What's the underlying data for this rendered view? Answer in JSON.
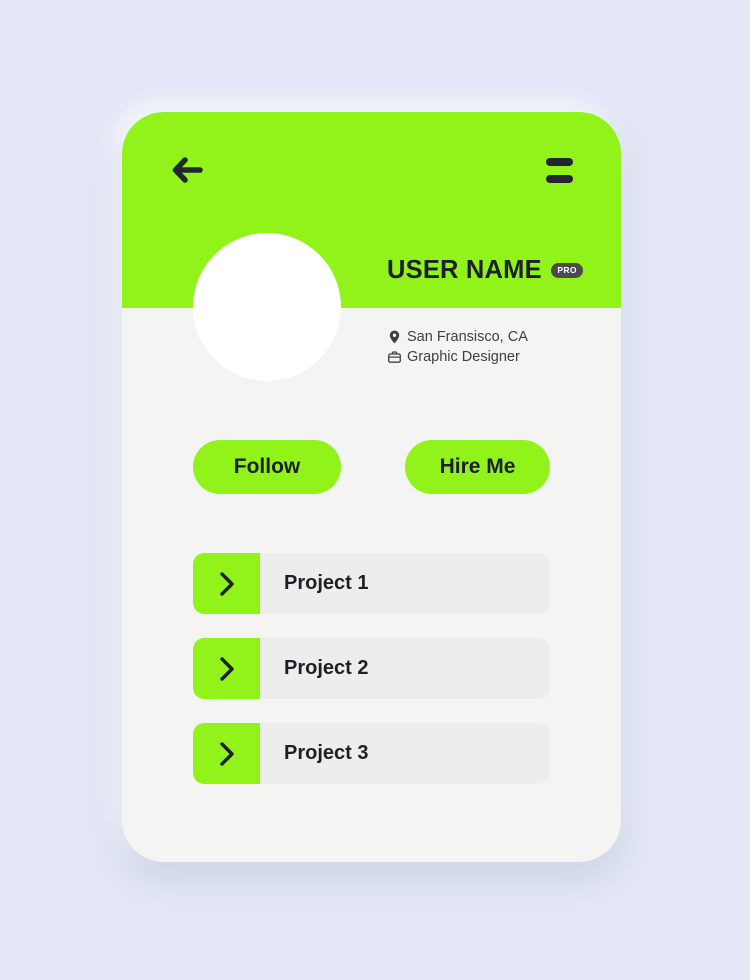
{
  "theme": {
    "accent_green": "#92f31b",
    "page_background": "#e3e7f6",
    "card_background": "#f4f4f2",
    "row_background": "#ededec",
    "dark_text": "#1d2026",
    "badge_background": "#4b4b4b"
  },
  "header": {
    "back_icon": "arrow-left-icon",
    "menu_icon": "hamburger-menu-icon"
  },
  "profile": {
    "avatar_icon": "avatar-placeholder",
    "user_name": "USER NAME",
    "pro_badge": "PRO",
    "location": "San Fransisco, CA",
    "location_icon": "map-pin-icon",
    "job_title": "Graphic Designer",
    "job_icon": "briefcase-icon"
  },
  "actions": {
    "follow_label": "Follow",
    "hire_label": "Hire Me"
  },
  "projects": {
    "chevron_icon": "chevron-right-icon",
    "items": [
      {
        "title": "Project 1"
      },
      {
        "title": "Project 2"
      },
      {
        "title": "Project 3"
      }
    ]
  }
}
